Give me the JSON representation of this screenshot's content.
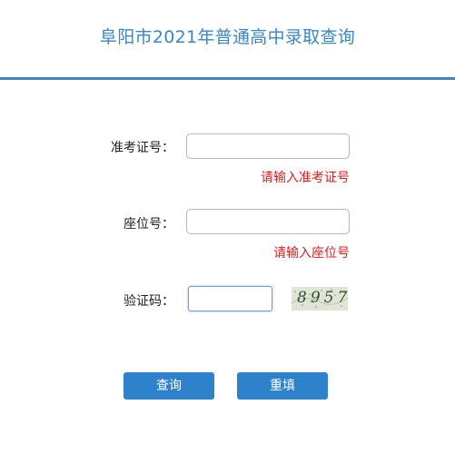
{
  "header": {
    "title": "阜阳市2021年普通高中录取查询",
    "accent_color": "#3b87c8"
  },
  "form": {
    "exam_number": {
      "label": "准考证号：",
      "value": "",
      "error": "请输入准考证号"
    },
    "seat_number": {
      "label": "座位号：",
      "value": "",
      "error": "请输入座位号"
    },
    "captcha": {
      "label": "验证码：",
      "value": "",
      "image_text": "8957"
    }
  },
  "buttons": {
    "query_label": "查询",
    "reset_label": "重填",
    "color": "#2e82cc"
  },
  "colors": {
    "error": "#e02020"
  }
}
